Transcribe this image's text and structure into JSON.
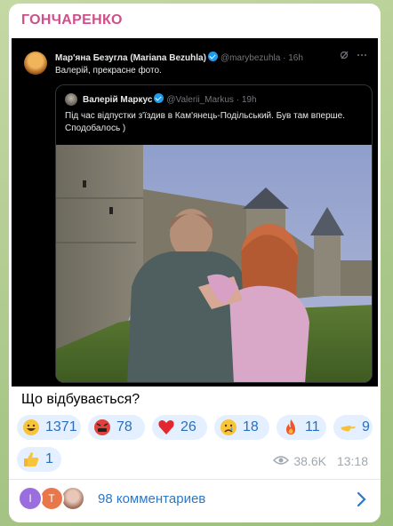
{
  "channel": {
    "name": "ГОНЧАРЕНКО"
  },
  "tweet": {
    "author": "Мар'яна Безугла (Mariana Bezuhla)",
    "handle": "@marybezuhla · 16h",
    "text": "Валерій, прекрасне фото.",
    "quoted": {
      "author": "Валерій Маркус",
      "handle": "@Valerii_Markus · 19h",
      "text": "Під час відпустки з'їздив в Кам'янець-Подільський. Був там вперше. Сподобалось )"
    }
  },
  "post": {
    "text": "Що відбувається?"
  },
  "reactions": [
    {
      "emoji": "grinning-face",
      "count": "1371"
    },
    {
      "emoji": "angry-face-with-symbols",
      "count": "78"
    },
    {
      "emoji": "red-heart",
      "count": "26"
    },
    {
      "emoji": "crying-face",
      "count": "18"
    },
    {
      "emoji": "fire",
      "count": "11"
    },
    {
      "emoji": "pointing-hand",
      "count": "9"
    },
    {
      "emoji": "thumbs-up",
      "count": "1"
    }
  ],
  "meta": {
    "views": "38.6K",
    "time": "13:18"
  },
  "comments": {
    "avatars": [
      {
        "letter": "I",
        "color": "#9b6ee0"
      },
      {
        "letter": "T",
        "color": "#e8774b"
      },
      {
        "letter": "",
        "color": "#c9a99a"
      }
    ],
    "label": "98 комментариев"
  },
  "colors": {
    "channel": "#cf4f8b",
    "reaction_bg": "#e4f0ff",
    "reaction_text": "#2a6fbd",
    "link": "#2a78c8"
  }
}
